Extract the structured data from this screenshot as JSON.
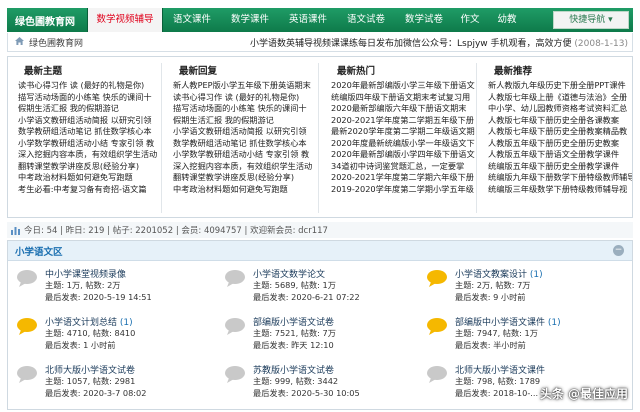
{
  "nav": {
    "brand": "绿色圃教育网",
    "items": [
      {
        "label": "数学视频辅导",
        "active": true
      },
      {
        "label": "语文课件",
        "active": false
      },
      {
        "label": "数学课件",
        "active": false
      },
      {
        "label": "英语课件",
        "active": false
      },
      {
        "label": "语文试卷",
        "active": false
      },
      {
        "label": "数学试卷",
        "active": false
      },
      {
        "label": "作文",
        "active": false
      },
      {
        "label": "幼教",
        "active": false
      }
    ],
    "quicknav": "快捷导航 ▾"
  },
  "breadcrumb": {
    "home_icon": "home-icon",
    "site": "绿色圃教育网",
    "notice": "小学语数英辅导视频课课练每日发布加微信公众号：Lspjyw 手机观看，高效方便",
    "notice_date": "(2008-1-13)"
  },
  "columns": [
    {
      "title": "最新主题",
      "items": [
        "读书心得习作 读 (最好的礼物是你)",
        "描写活动场面的小练笔 快乐的课间十",
        "假期生活汇报 我的假期游记",
        "小学语文教研组活动简报 以研究引领",
        "数学教研组活动笔记 抓住数学核心本",
        "小学数学教研组活动小结 专家引领 教",
        "深入挖掘内容本质，有效组织学生活动",
        "翻转课堂教学讲座反思(经验分享)",
        "中考政治材料题如何避免写跑题",
        "考生必看:中考复习备有奇招-语文篇"
      ]
    },
    {
      "title": "最新回复",
      "items": [
        "新人教PEP版小学五年级下册英语期末",
        "读书心得习作 读 (最好的礼物是你)",
        "描写活动场面的小练笔 快乐的课间十",
        "假期生活汇报 我的假期游记",
        "小学语文教研组活动简报 以研究引领",
        "数学教研组活动笔记 抓住数学核心本",
        "小学数学教研组活动小结 专家引领 教",
        "深入挖掘内容本质，有效组织学生活动",
        "翻转课堂教学讲座反思(经验分享)",
        "中考政治材料题如何避免写跑题"
      ]
    },
    {
      "title": "最新热门",
      "items": [
        "2020年最新部编版小学三年级下册语文",
        "统编版四年级下册语文期末考试复习用",
        "2020最新部编版六年级下册语文期末",
        "2020-2021学年度第二学期五年级下册",
        "最新2020学年度第二学期二年级语文期",
        "2020年度最新统编版小学一年级语文下",
        "2020年最新部编版小学四年级下册语文",
        "34道初中诗词鉴赏题汇总，一定要掌",
        "2020-2021学年度第二学期六年级下册",
        "2019-2020学年度第二学期小学五年级"
      ]
    },
    {
      "title": "最新推荐",
      "items": [
        "新人教版九年级历史下册全册PPT课件",
        "人教版七年级上册《道德与法治》全册",
        "中小学、幼儿园教师资格考试资料汇总",
        "人教版七年级下册历史全册各课教案",
        "人教版七年级下册历史全册教案精品教",
        "人教版五年级下册历史全册历史教案",
        "人教版五年级下册语文全册教学课件",
        "统编版五年级下册历史全册教学课件",
        "统编版九年级下册数学下册特级教师辅导视",
        "统编版三年级数学下册特级教师辅导视"
      ]
    }
  ],
  "stats": {
    "icon": "bar-chart-icon",
    "text": "今日: 54 | 昨日: 219 | 帖子: 2201052 | 会员: 4094757 | 欢迎新会员: dcr117"
  },
  "section": {
    "title": "小学语文区",
    "toggle_icon": "collapse-icon",
    "forums": [
      {
        "name": "中小学课堂视频录像",
        "today": "",
        "stat": "主题: 1万, 帖数: 2万",
        "last": "最后发表: 2020-5-19 14:51",
        "bubble_color": "#c9c9c9"
      },
      {
        "name": "小学语文数学论文",
        "today": "",
        "stat": "主题: 5689, 帖数: 1万",
        "last": "最后发表: 2020-6-21 07:22",
        "bubble_color": "#c9c9c9"
      },
      {
        "name": "小学语文教案设计",
        "today": "(1)",
        "stat": "主题: 2万, 帖数: 7万",
        "last": "最后发表: 9 小时前",
        "bubble_color": "#f5b800"
      },
      {
        "name": "小学语文计划总结",
        "today": "(1)",
        "stat": "主题: 4710, 帖数: 8410",
        "last": "最后发表: 1 小时前",
        "bubble_color": "#f5b800"
      },
      {
        "name": "部编版小学语文试卷",
        "today": "",
        "stat": "主题: 7521, 帖数: 7万",
        "last": "最后发表: 昨天 12:10",
        "bubble_color": "#c9c9c9"
      },
      {
        "name": "部编版中小学语文课件",
        "today": "(1)",
        "stat": "主题: 7947, 帖数: 1万",
        "last": "最后发表: 半小时前",
        "bubble_color": "#f5b800"
      },
      {
        "name": "北师大版小学语文试卷",
        "today": "",
        "stat": "主题: 1057, 帖数: 2981",
        "last": "最后发表: 2020-3-7 08:02",
        "bubble_color": "#c9c9c9"
      },
      {
        "name": "苏教版小学语文试卷",
        "today": "",
        "stat": "主题: 999, 帖数: 3442",
        "last": "最后发表: 2020-5-30 10:05",
        "bubble_color": "#c9c9c9"
      },
      {
        "name": "北师大版小学语文课件",
        "today": "",
        "stat": "主题: 798, 帖数: 1789",
        "last": "最后发表: 2018-10-...",
        "bubble_color": "#c9c9c9"
      }
    ]
  },
  "watermark": "头条 @最佳应用",
  "colors": {
    "nav_green": "#138556",
    "active_red": "#e0001b",
    "link_blue": "#1a6fb0"
  }
}
